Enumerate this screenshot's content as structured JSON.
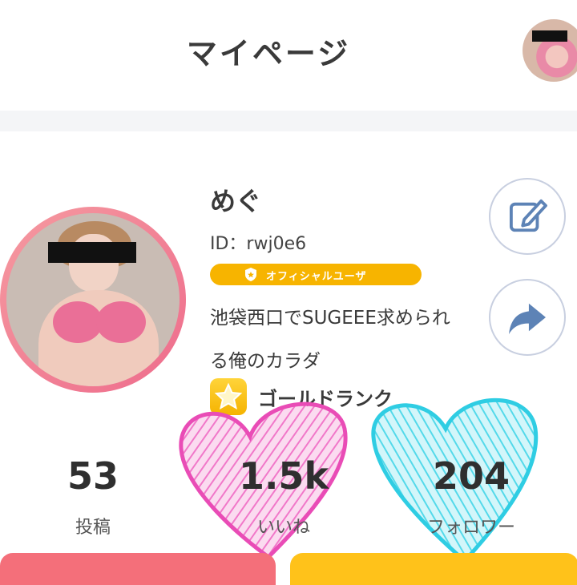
{
  "header": {
    "title": "マイページ"
  },
  "profile": {
    "name": "めぐ",
    "id_text": "ID：rwj0e6",
    "official_badge": "オフィシャルユーザ",
    "bio_line1": "池袋西口でSUGEEE求められ",
    "bio_line2": "る俺のカラダ",
    "rank": "ゴールドランク"
  },
  "stats": [
    {
      "value": "53",
      "label": "投稿"
    },
    {
      "value": "1.5k",
      "label": "いいね"
    },
    {
      "value": "204",
      "label": "フォロワー"
    }
  ],
  "colors": {
    "accent_yellow": "#f7b400",
    "ring_pink": "#ee6c8c",
    "heart_pink": "#f06fc4",
    "heart_cyan": "#36d6e8",
    "button_blue": "#5d83b6"
  },
  "icons": {
    "edit": "edit-icon",
    "share": "share-arrow-icon",
    "rank": "star-icon",
    "badge": "shield-icon"
  }
}
